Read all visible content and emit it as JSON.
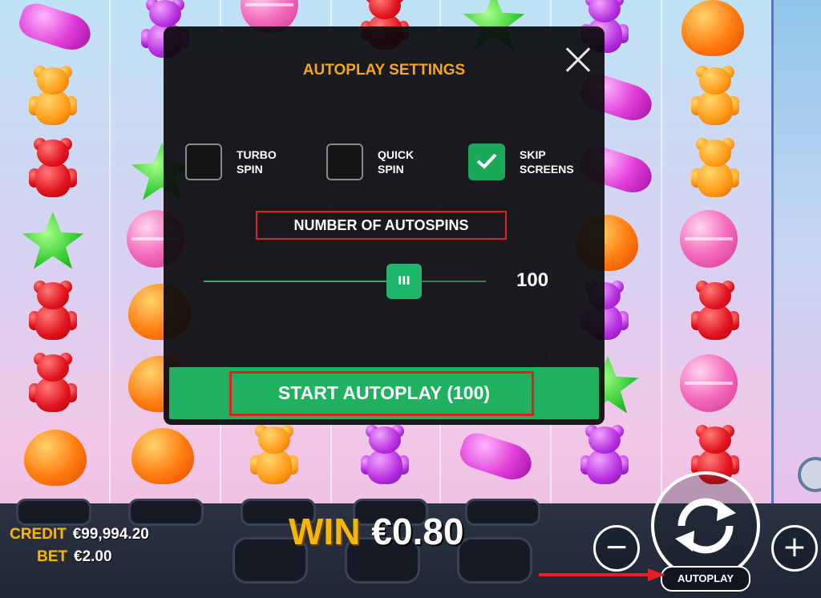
{
  "modal": {
    "title": "AUTOPLAY SETTINGS",
    "close_icon": "close-icon",
    "options": [
      {
        "label_line1": "TURBO",
        "label_line2": "SPIN",
        "checked": false
      },
      {
        "label_line1": "QUICK",
        "label_line2": "SPIN",
        "checked": false
      },
      {
        "label_line1": "SKIP",
        "label_line2": "SCREENS",
        "checked": true
      }
    ],
    "autospins_label": "NUMBER OF AUTOSPINS",
    "slider": {
      "value": "100",
      "thumb_glyph": "III",
      "fill_fraction": 0.71
    },
    "start_button": "START AUTOPLAY (100)"
  },
  "hud": {
    "credit_label": "CREDIT",
    "credit_value": "€99,994.20",
    "bet_label": "BET",
    "bet_value": "€2.00",
    "win_label": "WIN",
    "win_value": "€0.80",
    "minus_glyph": "−",
    "plus_glyph": "+",
    "autoplay_label": "AUTOPLAY",
    "spin_icon": "spin-arrows-icon"
  },
  "colors": {
    "accent_green": "#1fb15f",
    "title_orange": "#f5a623",
    "highlight_red": "#e31e24",
    "hud_gold": "#f5b800"
  }
}
